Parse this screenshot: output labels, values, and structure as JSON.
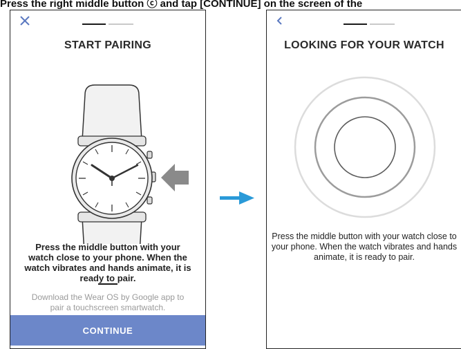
{
  "caption": "Press the right middle button ⓒ and tap [CONTINUE] on the screen of the",
  "screen1": {
    "close_icon": "close-icon",
    "title": "START PAIRING",
    "instruction": "Press the middle button with your watch close to your phone. When the watch vibrates and hands animate, it is ready to pair.",
    "secondary": "Download the Wear OS by Google app to pair a touchscreen smartwatch.",
    "continue_label": "CONTINUE",
    "progress_step": 1,
    "progress_total": 2
  },
  "screen2": {
    "back_icon": "chevron-left-icon",
    "title": "LOOKING FOR YOUR WATCH",
    "instruction": "Press the middle button with your watch close to your phone. When the watch vibrates and hands animate, it is ready to pair.",
    "progress_step": 1,
    "progress_total": 2
  },
  "colors": {
    "accent": "#6c87c9",
    "arrow": "#2a9ad8",
    "pointer_arrow": "#8a8a8a"
  }
}
